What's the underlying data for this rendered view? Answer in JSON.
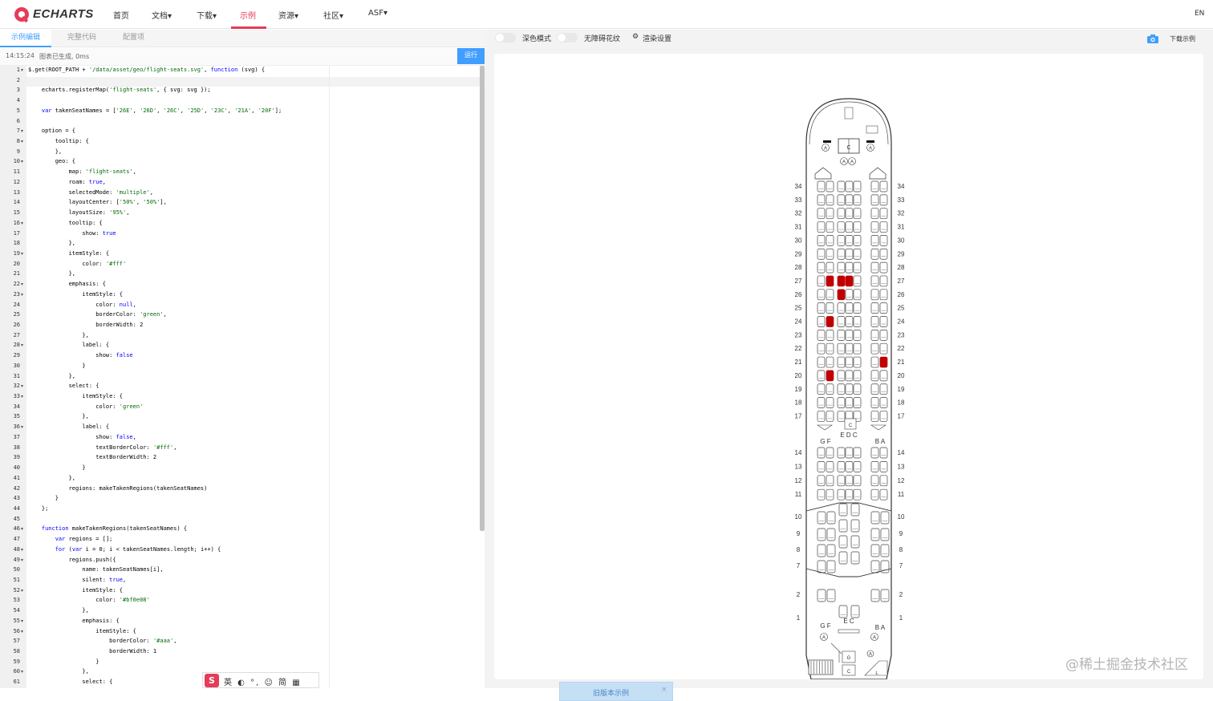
{
  "nav": {
    "logo_text": "ECHARTS",
    "items": [
      "首页",
      "文档▾",
      "下载▾",
      "示例",
      "资源▾",
      "社区▾",
      "ASF▾"
    ],
    "lang": "EN"
  },
  "editor": {
    "tabs": [
      "示例编辑",
      "完整代码",
      "配置项"
    ],
    "status_time": "14:15:24",
    "status_msg": "图表已生成, 0ms",
    "run_label": "运行"
  },
  "preview": {
    "dark_mode": "深色模式",
    "a11y": "无障碍花纹",
    "render_settings": "渲染设置",
    "download": "下载示例",
    "old_version": "旧版本示例",
    "close": "×"
  },
  "ime_bar": {
    "logo": "S",
    "items": "英 ◐ °, ☺ 简 ▦"
  },
  "watermark": "@稀土掘金技术社区",
  "colors": {
    "accent": "#e43c59",
    "link": "#409eff",
    "taken_seat": "#c00000",
    "keyword": "#0000ff",
    "string": "#036a07"
  },
  "code": [
    "$.get(ROOT_PATH + '/data/asset/geo/flight-seats.svg', function (svg) {",
    "",
    "    echarts.registerMap('flight-seats', { svg: svg });",
    "",
    "    var takenSeatNames = ['26E', '26D', '26C', '25D', '23C', '21A', '20F'];",
    "",
    "    option = {",
    "        tooltip: {",
    "        },",
    "        geo: {",
    "            map: 'flight-seats',",
    "            roam: true,",
    "            selectedMode: 'multiple',",
    "            layoutCenter: ['50%', '50%'],",
    "            layoutSize: '95%',",
    "            tooltip: {",
    "                show: true",
    "            },",
    "            itemStyle: {",
    "                color: '#fff'",
    "            },",
    "            emphasis: {",
    "                itemStyle: {",
    "                    color: null,",
    "                    borderColor: 'green',",
    "                    borderWidth: 2",
    "                },",
    "                label: {",
    "                    show: false",
    "                }",
    "            },",
    "            select: {",
    "                itemStyle: {",
    "                    color: 'green'",
    "                },",
    "                label: {",
    "                    show: false,",
    "                    textBorderColor: '#fff',",
    "                    textBorderWidth: 2",
    "                }",
    "            },",
    "            regions: makeTakenRegions(takenSeatNames)",
    "        }",
    "    };",
    "",
    "    function makeTakenRegions(takenSeatNames) {",
    "        var regions = [];",
    "        for (var i = 0; i < takenSeatNames.length; i++) {",
    "            regions.push({",
    "                name: takenSeatNames[i],",
    "                silent: true,",
    "                itemStyle: {",
    "                    color: '#bf0e08'",
    "                },",
    "                emphasis: {",
    "                    itemStyle: {",
    "                        borderColor: '#aaa',",
    "                        borderWidth: 1",
    "                    }",
    "                },",
    "                select: {"
  ],
  "fold_lines": [
    1,
    7,
    8,
    10,
    16,
    19,
    22,
    23,
    28,
    32,
    33,
    36,
    46,
    48,
    49,
    52,
    55,
    56,
    60
  ],
  "seatmap": {
    "rows_upper": [
      "34",
      "33",
      "32",
      "31",
      "30",
      "29",
      "28",
      "27",
      "26",
      "25",
      "24",
      "23",
      "22",
      "21",
      "20",
      "19",
      "18",
      "17"
    ],
    "rows_mid": [
      "14",
      "13",
      "12",
      "11"
    ],
    "rows_lower": [
      "10",
      "9",
      "8",
      "7",
      "2",
      "1"
    ],
    "letters_mid_left": "G F",
    "letters_mid_center": "E D C",
    "letters_mid_right": "B A",
    "letters_bottom_left": "G F",
    "letters_bottom_center": "E C",
    "letters_bottom_right": "B A",
    "taken": [
      "27D",
      "27E",
      "27F",
      "26E",
      "24F",
      "21A",
      "20F"
    ]
  }
}
